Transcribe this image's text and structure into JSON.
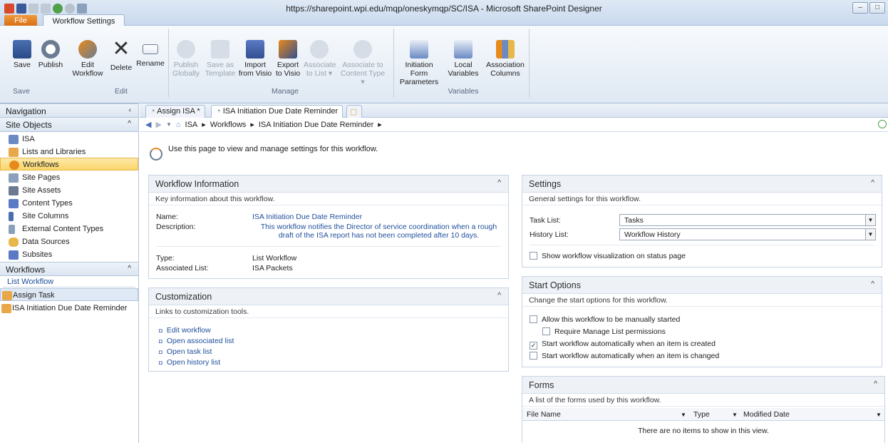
{
  "window": {
    "title": "https://sharepoint.wpi.edu/mqp/oneskymqp/SC/ISA - Microsoft SharePoint Designer"
  },
  "tabs": {
    "file": "File",
    "workflow_settings": "Workflow Settings"
  },
  "ribbon": {
    "save": "Save",
    "publish": "Publish",
    "edit_workflow_1": "Edit",
    "edit_workflow_2": "Workflow",
    "delete": "Delete",
    "rename": "Rename",
    "publish_globally_1": "Publish",
    "publish_globally_2": "Globally",
    "save_template_1": "Save as",
    "save_template_2": "Template",
    "import_visio_1": "Import",
    "import_visio_2": "from Visio",
    "export_visio_1": "Export",
    "export_visio_2": "to Visio",
    "assoc_list_1": "Associate",
    "assoc_list_2": "to List ▾",
    "assoc_ct_1": "Associate to",
    "assoc_ct_2": "Content Type ▾",
    "init_params_1": "Initiation Form",
    "init_params_2": "Parameters",
    "local_vars_1": "Local",
    "local_vars_2": "Variables",
    "assoc_cols_1": "Association",
    "assoc_cols_2": "Columns",
    "groups": {
      "save": "Save",
      "edit": "Edit",
      "manage": "Manage",
      "variables": "Variables"
    }
  },
  "nav": {
    "header": "Navigation",
    "site_objects": "Site Objects",
    "items": [
      "ISA",
      "Lists and Libraries",
      "Workflows",
      "Site Pages",
      "Site Assets",
      "Content Types",
      "Site Columns",
      "External Content Types",
      "Data Sources",
      "Subsites"
    ],
    "workflows_header": "Workflows",
    "list_workflow": "List Workflow",
    "wf_items": [
      "Assign Task",
      "ISA Initiation Due Date Reminder"
    ]
  },
  "doc_tabs": [
    "Assign ISA *",
    "ISA Initiation Due Date Reminder"
  ],
  "breadcrumb": {
    "root": "ISA",
    "b1": "Workflows",
    "b2": "ISA Initiation Due Date Reminder"
  },
  "intro": "Use this page to view and manage settings for this workflow.",
  "workflow_info": {
    "title": "Workflow Information",
    "subtitle": "Key information about this workflow.",
    "name_label": "Name:",
    "name_value": "ISA Initiation Due Date Reminder",
    "desc_label": "Description:",
    "desc_value_1": "This workflow notifies the Director of service coordination when a rough",
    "desc_value_2": "draft of the ISA report has not been completed after 10 days.",
    "type_label": "Type:",
    "type_value": "List Workflow",
    "assoc_label": "Associated List:",
    "assoc_value": "ISA Packets"
  },
  "customization": {
    "title": "Customization",
    "subtitle": "Links to customization tools.",
    "links": [
      "Edit workflow",
      "Open associated list",
      "Open task list",
      "Open history list"
    ]
  },
  "settings": {
    "title": "Settings",
    "subtitle": "General settings for this workflow.",
    "task_label": "Task List:",
    "task_value": "Tasks",
    "history_label": "History List:",
    "history_value": "Workflow History",
    "viz": "Show workflow visualization on status page"
  },
  "start_options": {
    "title": "Start Options",
    "subtitle": "Change the start options for this workflow.",
    "opt_manual": "Allow this workflow to be manually started",
    "opt_manage": "Require Manage List permissions",
    "opt_created": "Start workflow automatically when an item is created",
    "opt_changed": "Start workflow automatically when an item is changed"
  },
  "forms": {
    "title": "Forms",
    "subtitle": "A list of the forms used by this workflow.",
    "col_file": "File Name",
    "col_type": "Type",
    "col_modified": "Modified Date",
    "empty": "There are no items to show in this view."
  }
}
